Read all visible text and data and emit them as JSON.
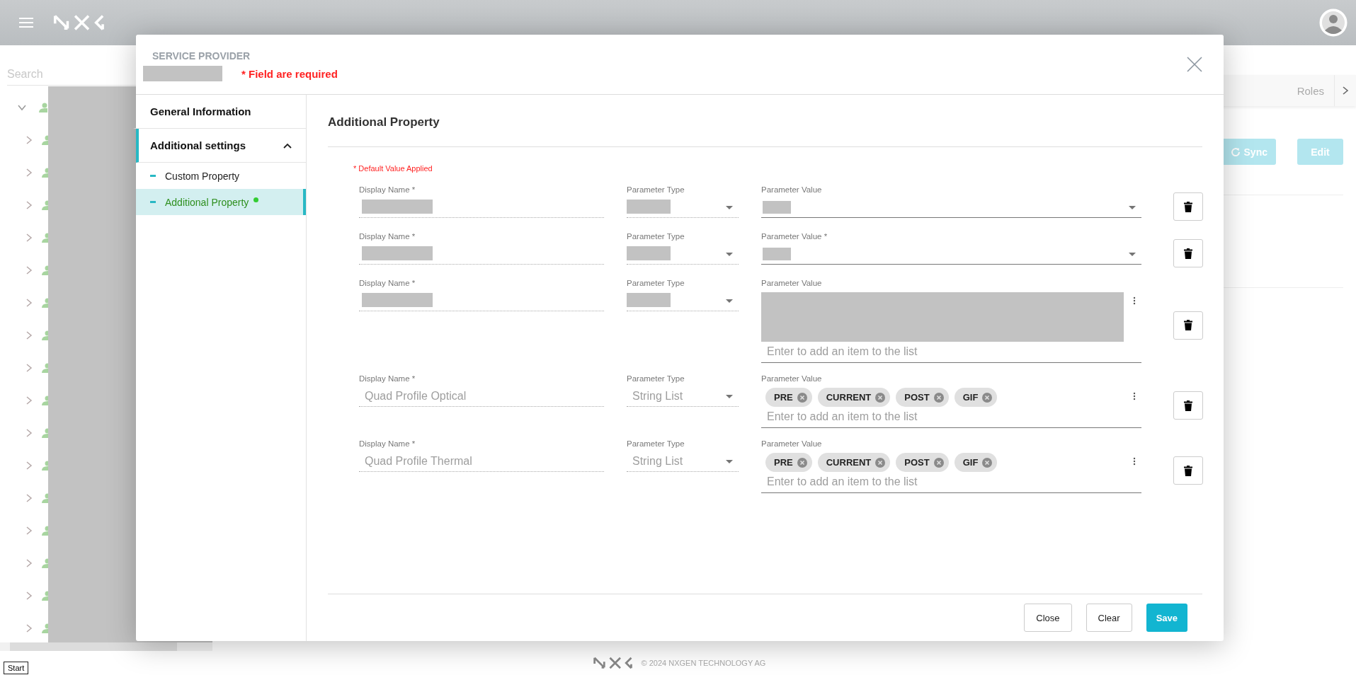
{
  "background": {
    "search": {
      "placeholder": "Search"
    },
    "tree": [
      {
        "expanded": true
      },
      {
        "expanded": false
      },
      {
        "expanded": false
      },
      {
        "expanded": false
      },
      {
        "expanded": false
      },
      {
        "expanded": false
      },
      {
        "expanded": false
      },
      {
        "expanded": false
      },
      {
        "expanded": false
      },
      {
        "expanded": false
      },
      {
        "expanded": false
      },
      {
        "expanded": false
      },
      {
        "expanded": false
      },
      {
        "expanded": false
      },
      {
        "expanded": false
      },
      {
        "expanded": false
      },
      {
        "expanded": false
      }
    ],
    "tab_label": "Roles",
    "buttons": [
      {
        "label": "Sync",
        "kind": "sync"
      },
      {
        "label": "Edit",
        "kind": "plain"
      }
    ]
  },
  "dialog": {
    "overline": "SERVICE PROVIDER",
    "title_redacted": true,
    "required_note": "* Field are required",
    "nav": [
      {
        "label": "General Information",
        "selected": false
      },
      {
        "label": "Additional settings",
        "selected": true,
        "expanded": true,
        "children": [
          {
            "label": "Custom Property",
            "selected": false,
            "modified": false
          },
          {
            "label": "Additional Property",
            "selected": true,
            "modified": true
          }
        ]
      }
    ],
    "title": "Additional Property",
    "default_note": "* Default Value Applied",
    "rows": [
      {
        "display_name": {
          "label": "Display Name *",
          "redacted": true
        },
        "parameter_type": {
          "label": "Parameter Type",
          "redacted": true
        },
        "parameter_value": {
          "label": "Parameter Value",
          "kind": "select",
          "redacted": true
        }
      },
      {
        "display_name": {
          "label": "Display Name *",
          "redacted": true
        },
        "parameter_type": {
          "label": "Parameter Type",
          "redacted": true
        },
        "parameter_value": {
          "label": "Parameter Value *",
          "kind": "select",
          "redacted": true
        }
      },
      {
        "display_name": {
          "label": "Display Name *",
          "redacted": true
        },
        "parameter_type": {
          "label": "Parameter Type",
          "redacted": true
        },
        "parameter_value": {
          "label": "Parameter Value",
          "kind": "list",
          "redacted": true,
          "placeholder": "Enter to add an item to the list"
        }
      },
      {
        "display_name": {
          "label": "Display Name *",
          "redacted": false,
          "value": "Quad Profile Optical"
        },
        "parameter_type": {
          "label": "Parameter Type",
          "redacted": false,
          "value": "String List"
        },
        "parameter_value": {
          "label": "Parameter Value",
          "kind": "list",
          "redacted": false,
          "items": [
            "PRE",
            "CURRENT",
            "POST",
            "GIF"
          ],
          "placeholder": "Enter to add an item to the list"
        }
      },
      {
        "display_name": {
          "label": "Display Name *",
          "redacted": false,
          "value": "Quad Profile Thermal"
        },
        "parameter_type": {
          "label": "Parameter Type",
          "redacted": false,
          "value": "String List"
        },
        "parameter_value": {
          "label": "Parameter Value",
          "kind": "list",
          "redacted": false,
          "items": [
            "PRE",
            "CURRENT",
            "POST",
            "GIF"
          ],
          "placeholder": "Enter to add an item to the list"
        }
      }
    ],
    "buttons": [
      {
        "label": "Close",
        "kind": "outlined"
      },
      {
        "label": "Clear",
        "kind": "outlined"
      },
      {
        "label": "Save",
        "kind": "primary"
      }
    ]
  },
  "footer": {
    "copyright": "© 2024 NXGEN TECHNOLOGY AG"
  },
  "tooltip": "Start"
}
